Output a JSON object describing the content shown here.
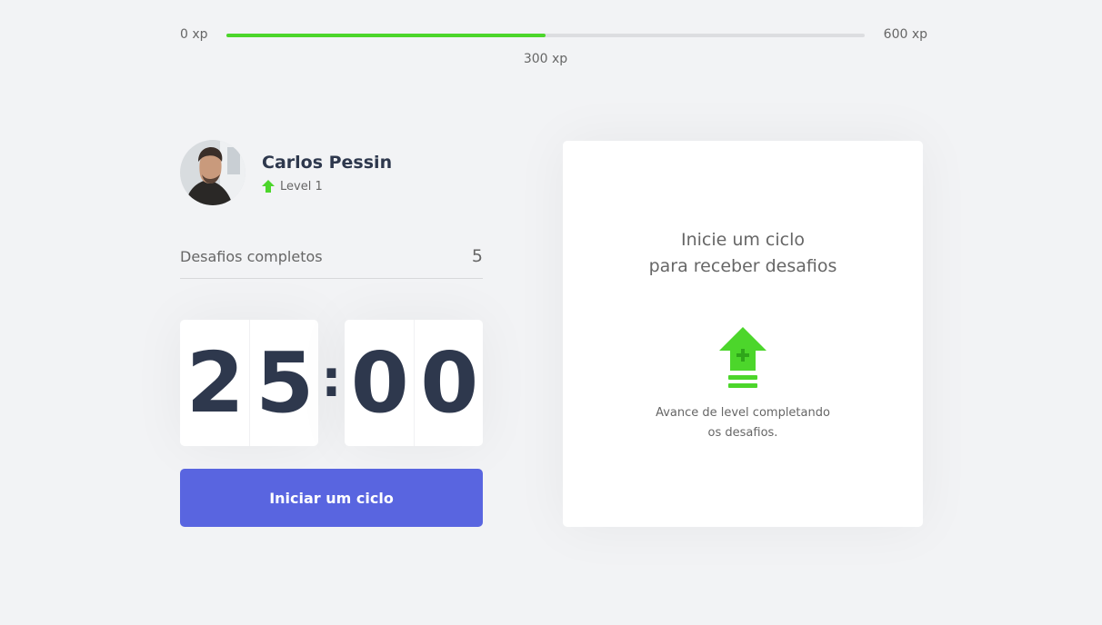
{
  "xp": {
    "min_label": "0 xp",
    "max_label": "600 xp",
    "current_label": "300 xp",
    "current_value": 300,
    "max_value": 600,
    "progress_fraction": 0.5
  },
  "profile": {
    "name": "Carlos Pessin",
    "level_label": "Level 1"
  },
  "challenges": {
    "completed_label": "Desafios completos",
    "completed_value": "5"
  },
  "countdown": {
    "minute_digits": [
      "2",
      "5"
    ],
    "separator": ":",
    "second_digits": [
      "0",
      "0"
    ]
  },
  "button": {
    "start_label": "Iniciar um ciclo"
  },
  "challenge_box": {
    "title_line1": "Inicie um ciclo",
    "title_line2": "para receber desafios",
    "description_line1": "Avance de level completando",
    "description_line2": "os desafios."
  },
  "colors": {
    "background": "#f2f3f5",
    "accent_green": "#4cd62b",
    "button_blue": "#5965e0",
    "title_dark": "#2e384d",
    "text_gray": "#666666"
  },
  "icons": {
    "level": "level-up-arrow-icon",
    "level_up": "level-up-icon"
  }
}
